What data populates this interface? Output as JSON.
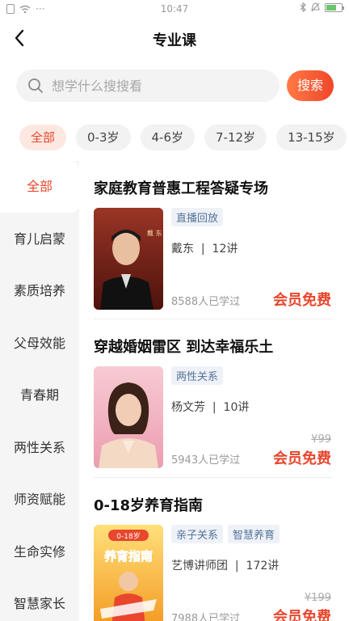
{
  "status_bar": {
    "time": "10:47",
    "battery_level": 0.65,
    "battery_color": "#6cc46c"
  },
  "nav": {
    "title": "专业课"
  },
  "search": {
    "placeholder": "想学什么搜搜看",
    "button_label": "搜索"
  },
  "age_tabs": [
    {
      "label": "全部",
      "active": true
    },
    {
      "label": "0-3岁",
      "active": false
    },
    {
      "label": "4-6岁",
      "active": false
    },
    {
      "label": "7-12岁",
      "active": false
    },
    {
      "label": "13-15岁",
      "active": false
    }
  ],
  "sidebar": {
    "items": [
      {
        "label": "全部",
        "active": true
      },
      {
        "label": "育儿启蒙",
        "active": false
      },
      {
        "label": "素质培养",
        "active": false
      },
      {
        "label": "父母效能",
        "active": false
      },
      {
        "label": "青春期",
        "active": false
      },
      {
        "label": "两性关系",
        "active": false
      },
      {
        "label": "师资赋能",
        "active": false
      },
      {
        "label": "生命实修",
        "active": false
      },
      {
        "label": "智慧家长",
        "active": false
      }
    ]
  },
  "courses": [
    {
      "title": "家庭教育普惠工程答疑专场",
      "tags": [
        "直播回放"
      ],
      "teacher": "戴东",
      "lessons": "12讲",
      "learners": "8588人已学过",
      "old_price": "",
      "vip_label": "会员免费",
      "thumb_text": "戴 东",
      "thumb_colors": [
        "#8a2a1f",
        "#5a1610"
      ]
    },
    {
      "title": "穿越婚姻雷区  到达幸福乐土",
      "tags": [
        "两性关系"
      ],
      "teacher": "杨文芳",
      "lessons": "10讲",
      "learners": "5943人已学过",
      "old_price": "¥99",
      "vip_label": "会员免费",
      "thumb_text": "",
      "thumb_colors": [
        "#f6c2cc",
        "#ee9eb0"
      ]
    },
    {
      "title": "0-18岁养育指南",
      "tags": [
        "亲子关系",
        "智慧养育"
      ],
      "teacher": "艺博讲师团",
      "lessons": "172讲",
      "learners": "7988人已学过",
      "old_price": "¥199",
      "vip_label": "会员免费",
      "thumb_text": "养育指南",
      "thumb_badge": "0-18岁",
      "thumb_colors": [
        "#ffd24a",
        "#f5a623"
      ]
    }
  ],
  "colors": {
    "accent": "#e8462d",
    "tag_text": "#557399",
    "tag_bg": "#eef2f8"
  }
}
